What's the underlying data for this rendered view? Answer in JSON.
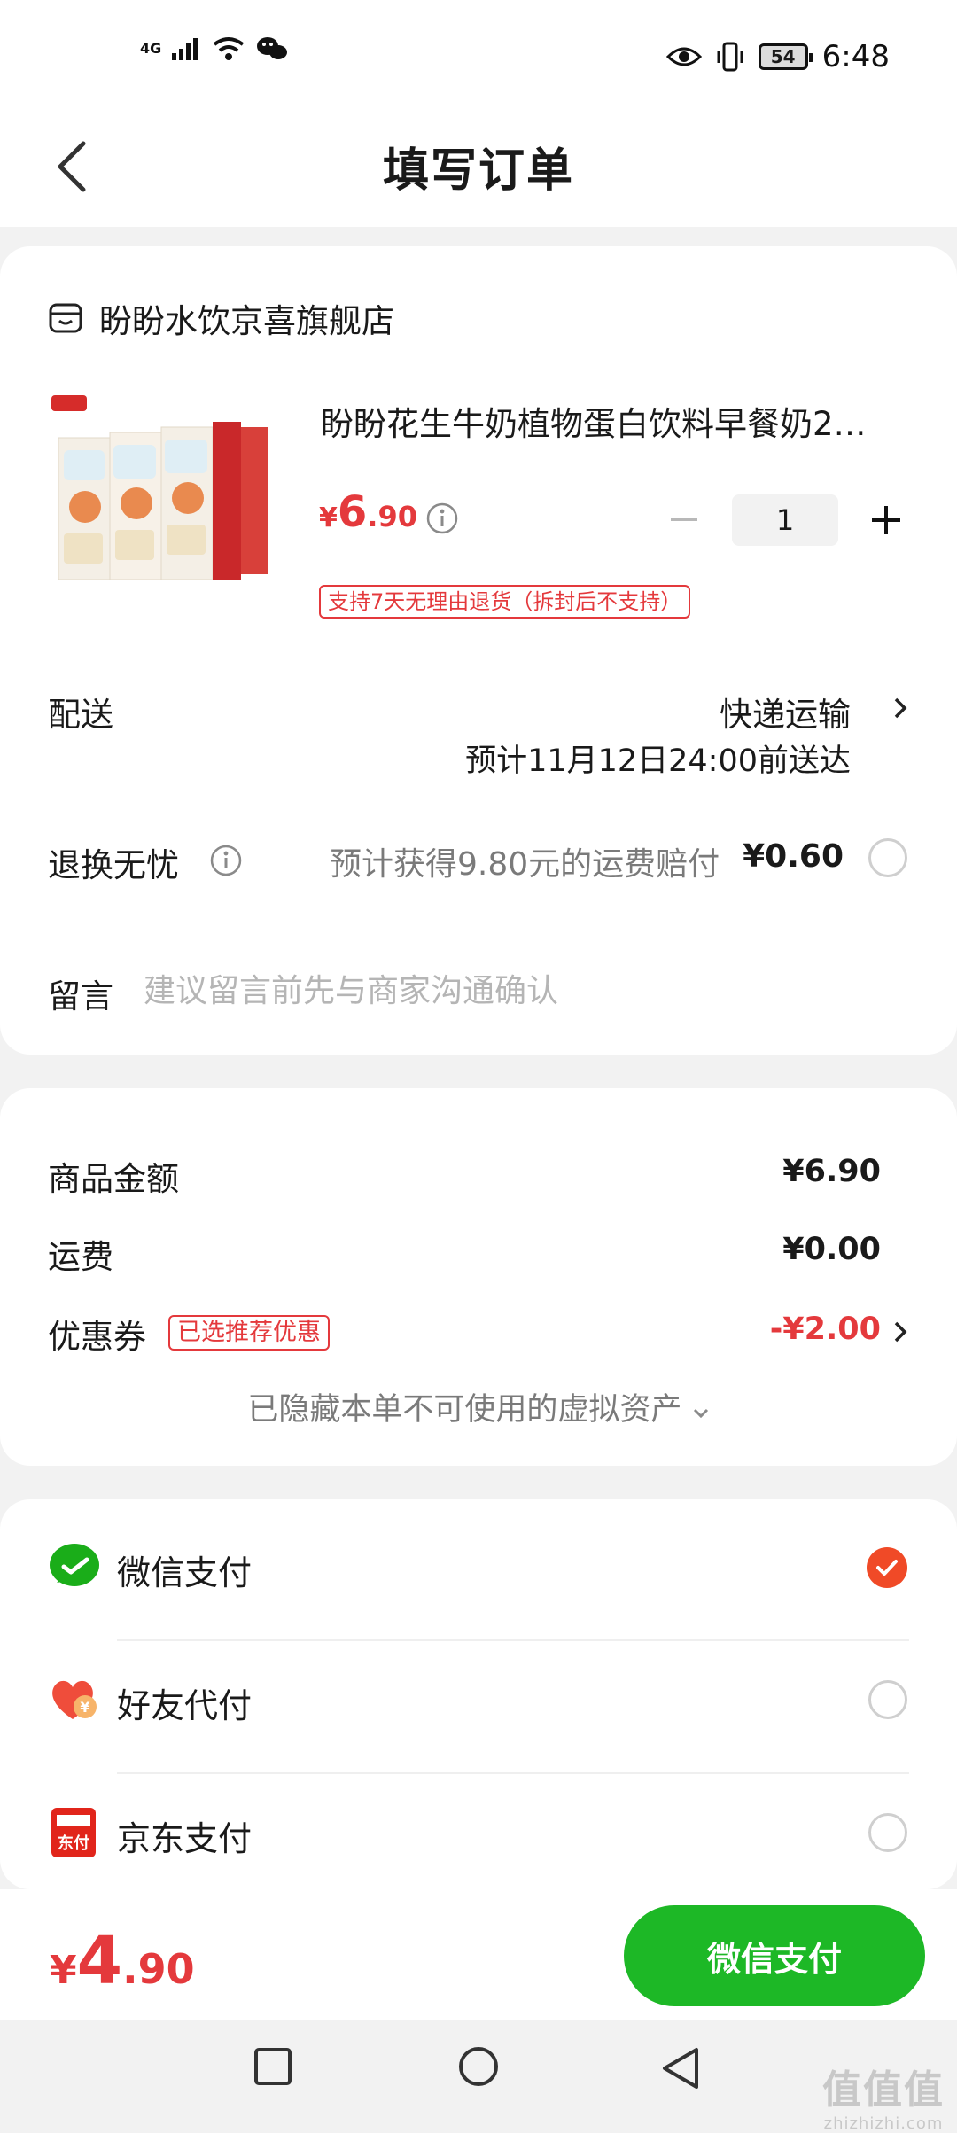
{
  "status_bar": {
    "network": "4G",
    "battery": "54",
    "time": "6:48"
  },
  "header": {
    "title": "填写订单"
  },
  "shop": {
    "name": "盼盼水饮京喜旗舰店"
  },
  "product": {
    "title": "盼盼花生牛奶植物蛋白饮料早餐奶2…",
    "price_currency": "¥",
    "price_int": "6",
    "price_dec": ".90",
    "quantity": "1",
    "return_policy": "支持7天无理由退货（拆封后不支持）"
  },
  "delivery": {
    "label": "配送",
    "method": "快递运输",
    "eta": "预计11月12日24:00前送达"
  },
  "worry_free": {
    "label": "退换无忧",
    "text": "预计获得9.80元的运费赔付",
    "price": "¥0.60"
  },
  "note": {
    "label": "留言",
    "placeholder": "建议留言前先与商家沟通确认"
  },
  "summary": {
    "goods_label": "商品金额",
    "goods_value": "¥6.90",
    "shipping_label": "运费",
    "shipping_value": "¥0.00",
    "coupon_label": "优惠券",
    "coupon_badge": "已选推荐优惠",
    "coupon_value": "-¥2.00",
    "hidden_assets": "已隐藏本单不可使用的虚拟资产"
  },
  "payment": {
    "methods": [
      {
        "label": "微信支付",
        "selected": true
      },
      {
        "label": "好友代付",
        "selected": false
      },
      {
        "label": "京东支付",
        "selected": false
      }
    ],
    "jd_icon_text": "东付"
  },
  "footer": {
    "total_currency": "¥",
    "total_int": "4",
    "total_dec": ".90",
    "pay_button": "微信支付"
  },
  "watermark": {
    "main": "值值值",
    "sub": "zhizhizhi.com"
  },
  "colors": {
    "accent_red": "#e4393c",
    "wechat_green": "#1db826",
    "checked_orange": "#f04a27"
  }
}
